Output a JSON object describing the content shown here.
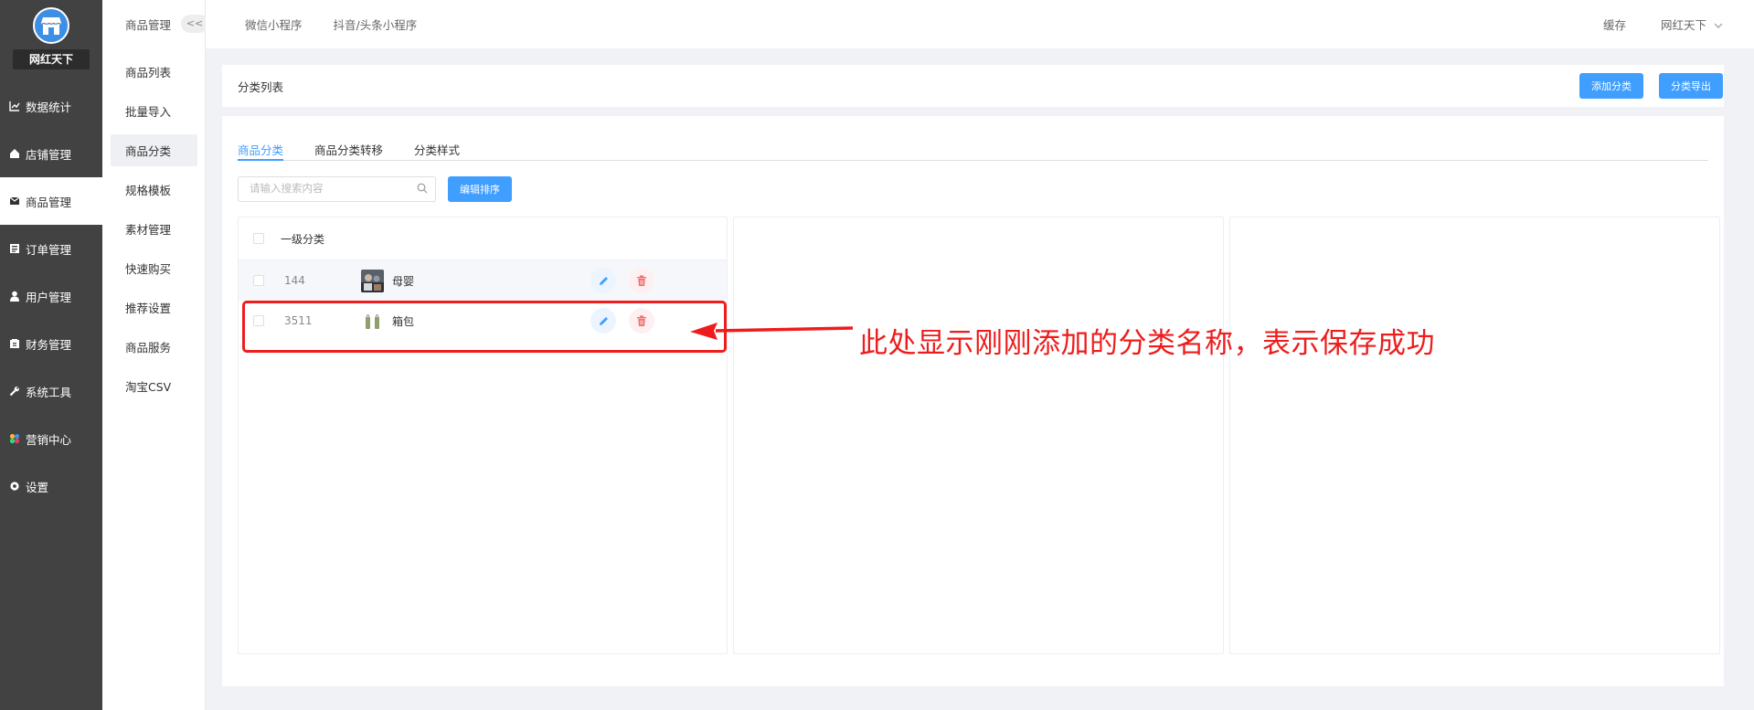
{
  "sidebar": {
    "brand": "网红天下",
    "items": [
      {
        "label": "数据统计",
        "icon": "chart-icon"
      },
      {
        "label": "店铺管理",
        "icon": "home-icon"
      },
      {
        "label": "商品管理",
        "icon": "box-icon",
        "active": true
      },
      {
        "label": "订单管理",
        "icon": "list-icon"
      },
      {
        "label": "用户管理",
        "icon": "user-icon"
      },
      {
        "label": "财务管理",
        "icon": "wallet-icon"
      },
      {
        "label": "系统工具",
        "icon": "wrench-icon"
      },
      {
        "label": "营销中心",
        "icon": "marketing-icon"
      },
      {
        "label": "设置",
        "icon": "gear-icon"
      }
    ]
  },
  "subnav": {
    "title": "商品管理",
    "collapse": "<<",
    "items": [
      {
        "label": "商品列表"
      },
      {
        "label": "批量导入"
      },
      {
        "label": "商品分类",
        "active": true
      },
      {
        "label": "规格模板"
      },
      {
        "label": "素材管理"
      },
      {
        "label": "快速购买"
      },
      {
        "label": "推荐设置"
      },
      {
        "label": "商品服务"
      },
      {
        "label": "淘宝CSV"
      }
    ]
  },
  "topbar": {
    "tabs": [
      "微信小程序",
      "抖音/头条小程序"
    ],
    "cache": "缓存",
    "user": "网红天下"
  },
  "header": {
    "title": "分类列表",
    "add_button": "添加分类",
    "export_button": "分类导出"
  },
  "tabs": [
    "商品分类",
    "商品分类转移",
    "分类样式"
  ],
  "search": {
    "placeholder": "请输入搜索内容"
  },
  "sort_button": "编辑排序",
  "category_panel": {
    "header": "一级分类",
    "rows": [
      {
        "id": "144",
        "name": "母婴"
      },
      {
        "id": "3511",
        "name": "箱包"
      }
    ]
  },
  "annotation": {
    "text": "此处显示刚刚添加的分类名称，表示保存成功",
    "color": "#ee1c1c"
  },
  "colors": {
    "primary": "#409eff",
    "sidebar": "#424242",
    "danger": "#f56c6c"
  }
}
